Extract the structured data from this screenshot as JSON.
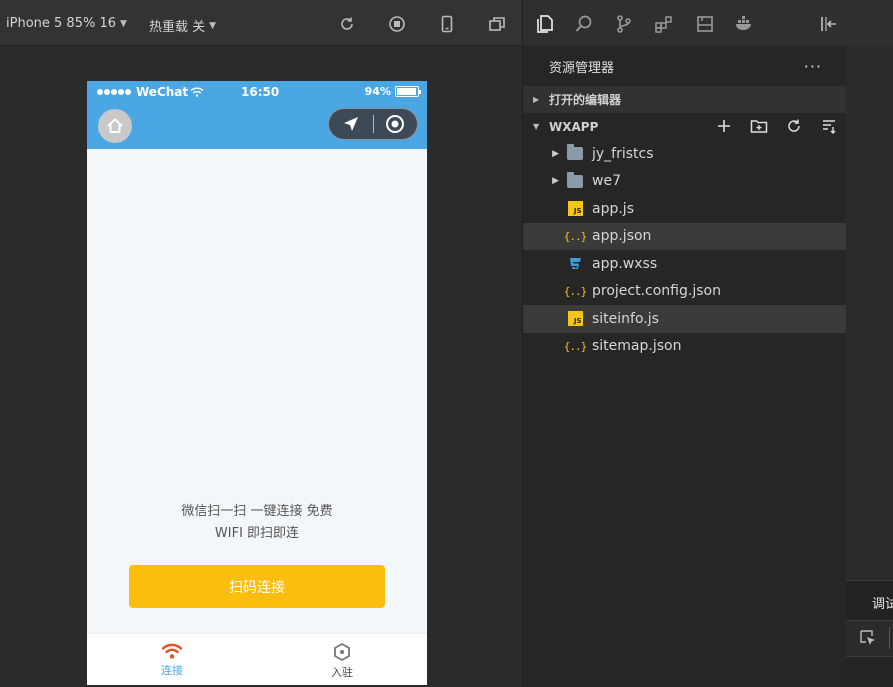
{
  "toolbar": {
    "device_select": "iPhone 5 85% 16",
    "hot_reload": "热重载 关",
    "icons": [
      "refresh-icon",
      "stop-icon",
      "phone-icon",
      "window-icon"
    ]
  },
  "phone": {
    "status": {
      "carrier": "WeChat",
      "time": "16:50",
      "battery": "94%",
      "battery_level": 0.94
    },
    "tagline_line1": "微信扫一扫 一键连接 免费",
    "tagline_line2": "WIFI 即扫即连",
    "scan_button": "扫码连接",
    "tabs": [
      {
        "label": "连接",
        "icon": "wifi-icon",
        "active": true
      },
      {
        "label": "入驻",
        "icon": "hexagon-icon",
        "active": false
      }
    ],
    "colors": {
      "nav": "#4ba7e4",
      "button": "#fbbd0e",
      "wifi_icon": "#e8502a"
    }
  },
  "explorer": {
    "title": "资源管理器",
    "more": "···",
    "open_editors": "打开的编辑器",
    "project": "WXAPP",
    "files": [
      {
        "name": "jy_fristcs",
        "type": "folder"
      },
      {
        "name": "we7",
        "type": "folder"
      },
      {
        "name": "app.js",
        "type": "js"
      },
      {
        "name": "app.json",
        "type": "json",
        "selected": true
      },
      {
        "name": "app.wxss",
        "type": "css"
      },
      {
        "name": "project.config.json",
        "type": "json"
      },
      {
        "name": "siteinfo.js",
        "type": "js",
        "selected": true
      },
      {
        "name": "sitemap.json",
        "type": "json"
      }
    ]
  },
  "debug": {
    "tab_label": "调试"
  }
}
